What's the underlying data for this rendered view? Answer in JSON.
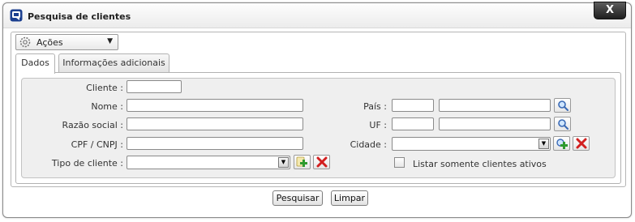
{
  "window": {
    "title": "Pesquisa de clientes",
    "close_label": "X"
  },
  "actions_menu": {
    "label": "Ações"
  },
  "tabs": [
    {
      "label": "Dados"
    },
    {
      "label": "Informações adicionais"
    }
  ],
  "form": {
    "cliente": {
      "label": "Cliente :",
      "value": ""
    },
    "nome": {
      "label": "Nome :",
      "value": ""
    },
    "razao_social": {
      "label": "Razão social :",
      "value": ""
    },
    "cpf_cnpj": {
      "label": "CPF / CNPJ :",
      "value": ""
    },
    "tipo_cliente": {
      "label": "Tipo de cliente :",
      "selected": ""
    },
    "pais": {
      "label": "País :",
      "code": "",
      "name": ""
    },
    "uf": {
      "label": "UF :",
      "code": "",
      "name": ""
    },
    "cidade": {
      "label": "Cidade :",
      "selected": ""
    },
    "somente_ativos": {
      "label": "Listar somente clientes ativos",
      "checked": false
    }
  },
  "buttons": {
    "search": "Pesquisar",
    "clear": "Limpar"
  }
}
